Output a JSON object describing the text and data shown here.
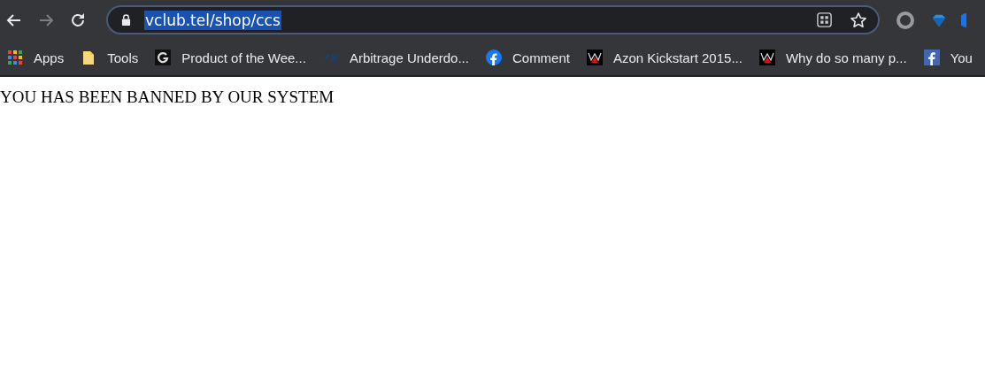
{
  "toolbar": {
    "address": {
      "url": "vclub.tel/shop/ccs",
      "selected": true
    }
  },
  "bookmarks": [
    {
      "kind": "apps",
      "label": "Apps"
    },
    {
      "kind": "folder",
      "label": "Tools"
    },
    {
      "kind": "g-logo",
      "label": "Product of the Wee..."
    },
    {
      "kind": "x-logo",
      "label": "Arbitrage Underdo..."
    },
    {
      "kind": "fb-round",
      "label": "Comment"
    },
    {
      "kind": "w-logo",
      "label": "Azon Kickstart 2015..."
    },
    {
      "kind": "w-logo",
      "label": "Why do so many p..."
    },
    {
      "kind": "fb-square",
      "label": "You"
    }
  ],
  "page": {
    "message": "YOU HAS BEEN BANNED BY OUR SYSTEM"
  }
}
